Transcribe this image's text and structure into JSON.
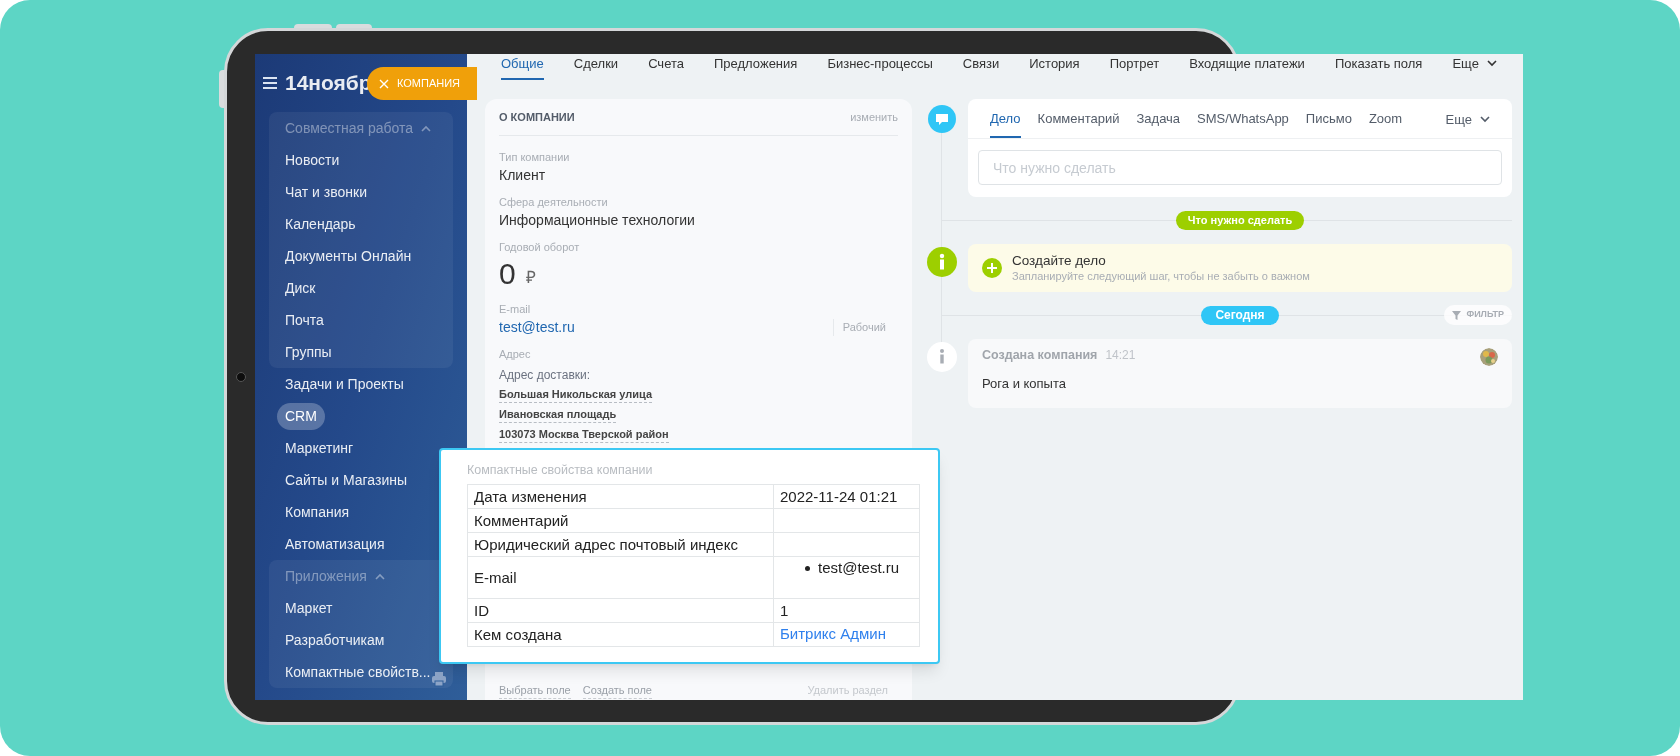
{
  "sidebar": {
    "logo": "14ноябр",
    "badge": "КОМПАНИЯ",
    "items": [
      {
        "kind": "group",
        "label": "Совместная работа",
        "expanded": true,
        "children": [
          {
            "label": "Новости",
            "selected": false
          },
          {
            "label": "Чат и звонки",
            "selected": false
          },
          {
            "label": "Календарь",
            "selected": false
          },
          {
            "label": "Документы Онлайн",
            "selected": false
          },
          {
            "label": "Диск",
            "selected": false
          },
          {
            "label": "Почта",
            "selected": false
          },
          {
            "label": "Группы",
            "selected": false
          }
        ]
      },
      {
        "kind": "link",
        "label": "Задачи и Проекты",
        "selected": false
      },
      {
        "kind": "link",
        "label": "CRM",
        "selected": true
      },
      {
        "kind": "link",
        "label": "Маркетинг",
        "selected": false
      },
      {
        "kind": "link",
        "label": "Сайты и Магазины",
        "selected": false
      },
      {
        "kind": "link",
        "label": "Компания",
        "selected": false
      },
      {
        "kind": "link",
        "label": "Автоматизация",
        "selected": false
      },
      {
        "kind": "group",
        "label": "Приложения",
        "expanded": true,
        "children": [
          {
            "label": "Маркет",
            "selected": false
          },
          {
            "label": "Разработчикам",
            "selected": false
          },
          {
            "label": "Компактные свойств...",
            "selected": false
          }
        ]
      }
    ]
  },
  "tabs": [
    {
      "kind": "tab",
      "label": "Общие",
      "selected": true
    },
    {
      "kind": "tab",
      "label": "Сделки",
      "selected": false
    },
    {
      "kind": "tab",
      "label": "Счета",
      "selected": false
    },
    {
      "kind": "tab",
      "label": "Предложения",
      "selected": false
    },
    {
      "kind": "tab",
      "label": "Бизнес-процессы",
      "selected": false
    },
    {
      "kind": "tab",
      "label": "Связи",
      "selected": false
    },
    {
      "kind": "tab",
      "label": "История",
      "selected": false
    },
    {
      "kind": "tab",
      "label": "Портрет",
      "selected": false
    },
    {
      "kind": "tab",
      "label": "Входящие платежи",
      "selected": false
    },
    {
      "kind": "tab",
      "label": "Показать поля",
      "selected": false
    },
    {
      "kind": "more",
      "label": "Еще",
      "selected": false
    }
  ],
  "company_card": {
    "title": "О КОМПАНИИ",
    "edit_link": "изменить",
    "fields": [
      {
        "kind": "text",
        "label": "Тип компании",
        "value": "Клиент"
      },
      {
        "kind": "text",
        "label": "Сфера деятельности",
        "value": "Информационные технологии"
      },
      {
        "kind": "money",
        "label": "Годовой оборот",
        "value": "0",
        "currency": "₽"
      },
      {
        "kind": "email",
        "label": "E-mail",
        "value": "test@test.ru",
        "type": "Рабочий"
      },
      {
        "kind": "address",
        "label": "Адрес",
        "sublabel": "Адрес доставки:",
        "lines": [
          "Большая Никольская улица",
          "Ивановская площадь",
          "103073 Москва Тверской район"
        ]
      }
    ],
    "footer_links": [
      "Выбрать поле",
      "Создать поле"
    ],
    "delete_link": "Удалить раздел"
  },
  "timeline": {
    "composer": {
      "tabs": [
        {
          "label": "Дело",
          "selected": true
        },
        {
          "label": "Комментарий",
          "selected": false
        },
        {
          "label": "Задача",
          "selected": false
        },
        {
          "label": "SMS/WhatsApp",
          "selected": false
        },
        {
          "label": "Письмо",
          "selected": false
        },
        {
          "label": "Zoom",
          "selected": false
        }
      ],
      "more": "Еще",
      "placeholder": "Что нужно сделать"
    },
    "planned_label": "Что нужно сделать",
    "hint": {
      "title": "Создайте дело",
      "text": "Запланируйте следующий шаг, чтобы не забыть о важном"
    },
    "today_label": "Сегодня",
    "filter": "ФИЛЬТР",
    "events": [
      {
        "title": "Создана компания",
        "time": "14:21",
        "text": "Рога и копыта"
      }
    ]
  },
  "properties_popup": {
    "title": "Компактные свойства компании",
    "rows": [
      {
        "kind": "text",
        "name": "Дата изменения",
        "value": "2022-11-24 01:21"
      },
      {
        "kind": "text",
        "name": "Комментарий"
      },
      {
        "kind": "text",
        "name": "Юридический адрес почтовый индекс"
      },
      {
        "kind": "list",
        "name": "E-mail",
        "items": [
          "test@test.ru"
        ]
      },
      {
        "kind": "text",
        "name": "ID",
        "value": "1"
      },
      {
        "kind": "link",
        "name": "Кем создана",
        "value": "Битрикс Админ"
      }
    ]
  }
}
